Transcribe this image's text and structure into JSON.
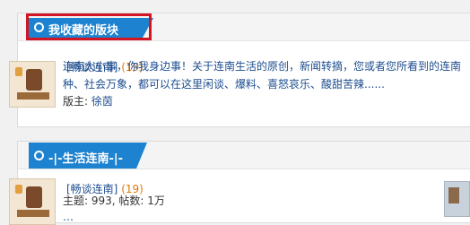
{
  "favorites": {
    "title": "我收藏的版块",
    "forum": {
      "name": "[畅谈连南]",
      "count": "(19)"
    },
    "description_lines": [
      "连南大小事，你我身边事！关于连南生活的原创，新闻转摘，您或者您所看到的连南",
      "种、社会万象，都可以在这里闲谈、爆料、喜怒哀乐、酸甜苦辣......"
    ],
    "owner_label": "版主:",
    "owner_name": "徐茵"
  },
  "life_section": {
    "title": "-|-生活连南-|-",
    "forum": {
      "name": "[畅谈连南]",
      "count": "(19)"
    },
    "stats": "主题: 993, 帖数: 1万",
    "partial_line": "…"
  },
  "colors": {
    "tab_blue": "#1d82cf",
    "link_blue": "#1d4d8f",
    "count_orange": "#e0780a",
    "highlight_red": "#d21522"
  },
  "icons": {
    "tab_icon": "circle-icon",
    "thumbnail": "forum-thumbnail"
  }
}
